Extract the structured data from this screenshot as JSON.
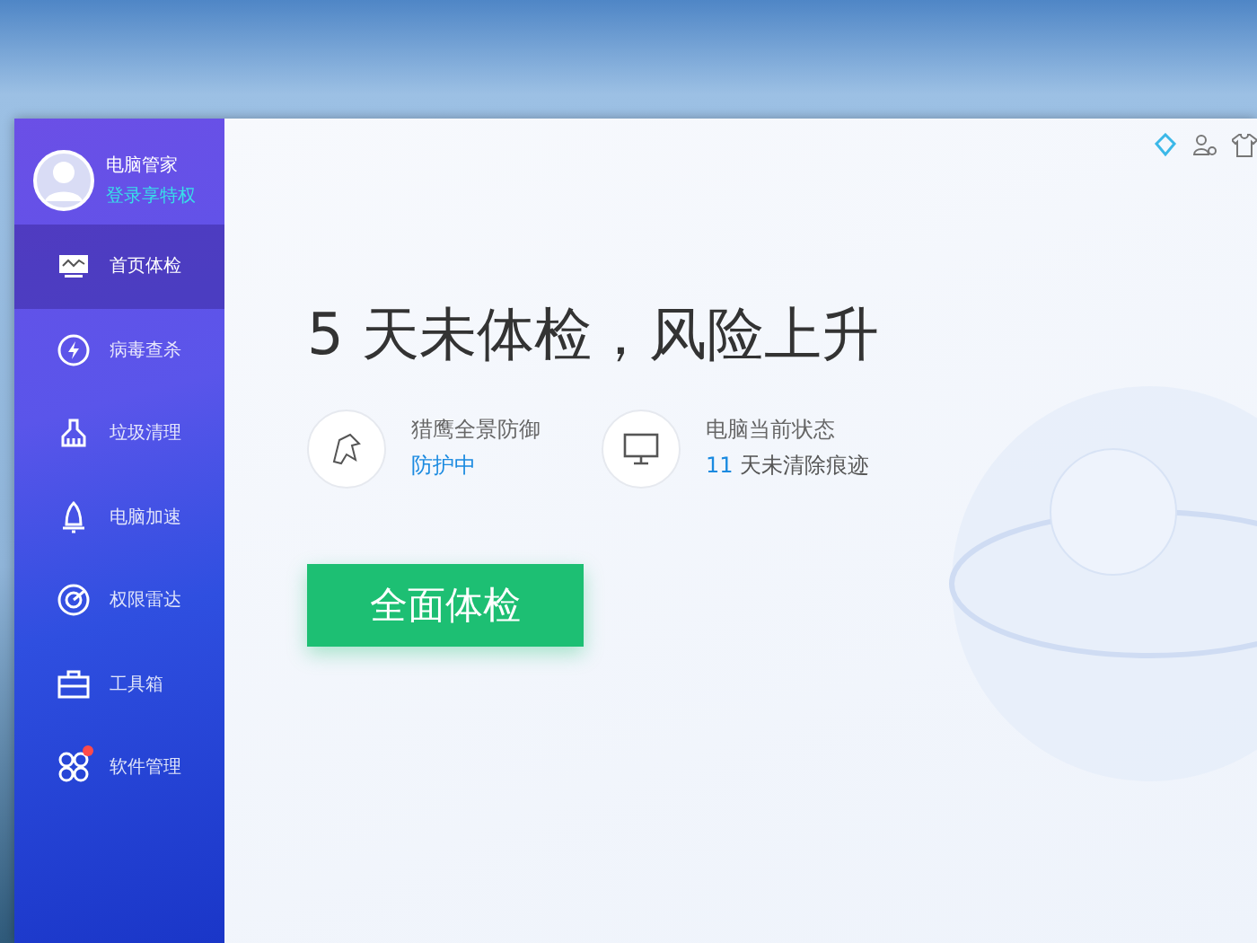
{
  "sidebar": {
    "user": {
      "name": "电脑管家",
      "link": "登录享特权"
    },
    "items": [
      {
        "label": "首页体检",
        "selected": true,
        "dot": false
      },
      {
        "label": "病毒查杀",
        "selected": false,
        "dot": false
      },
      {
        "label": "垃圾清理",
        "selected": false,
        "dot": false
      },
      {
        "label": "电脑加速",
        "selected": false,
        "dot": false
      },
      {
        "label": "权限雷达",
        "selected": false,
        "dot": false
      },
      {
        "label": "工具箱",
        "selected": false,
        "dot": false
      },
      {
        "label": "软件管理",
        "selected": false,
        "dot": true
      }
    ]
  },
  "main": {
    "headline": "5 天未体检，风险上升",
    "status": [
      {
        "title": "猎鹰全景防御",
        "highlight": "防护中"
      },
      {
        "title": "电脑当前状态",
        "highlight": "11",
        "rest": "天未清除痕迹"
      }
    ],
    "button": "全面体检"
  }
}
